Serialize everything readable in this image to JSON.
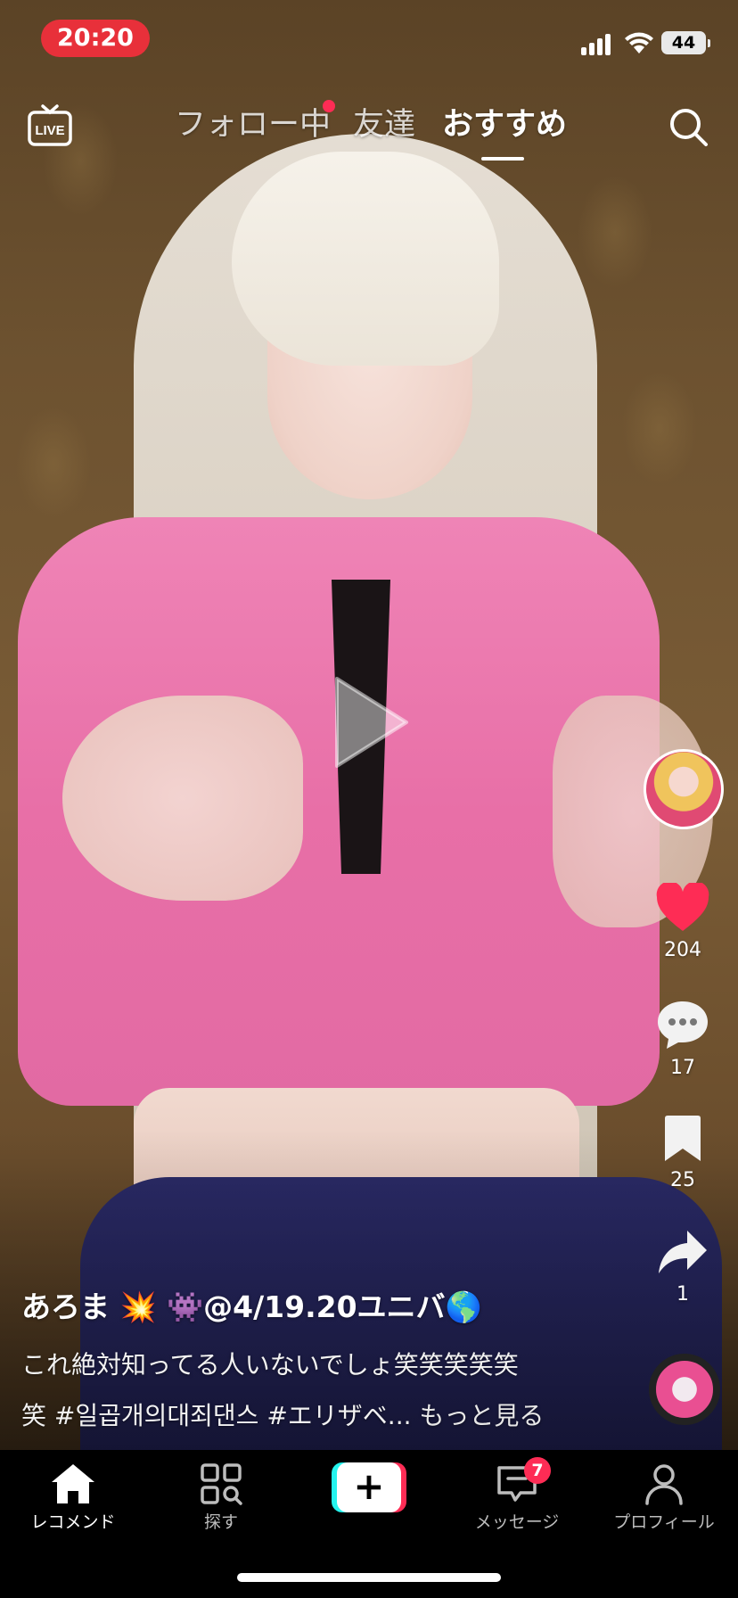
{
  "status_bar": {
    "time": "20:20",
    "battery": "44"
  },
  "top_nav": {
    "live_label": "LIVE",
    "tabs": [
      {
        "label": "フォロー中"
      },
      {
        "label": "友達"
      },
      {
        "label": "おすすめ"
      }
    ]
  },
  "actions": {
    "likes": "204",
    "comments": "17",
    "saves": "25",
    "shares": "1"
  },
  "caption": {
    "username": "あろま 💥 👾@4/19.20ユニバ🌎",
    "line1": "これ絶対知ってる人いないでしょ笑笑笑笑笑",
    "line2": "笑  #일곱개의대죄댄스 #エリザベ...",
    "more": "もっと見る"
  },
  "tabbar": {
    "home": "レコメンド",
    "discover": "探す",
    "inbox": "メッセージ",
    "inbox_badge": "7",
    "profile": "プロフィール",
    "create": "+"
  },
  "colors": {
    "accent": "#fe2c55",
    "cyan": "#25f4ee",
    "time_pill": "#e8303a"
  }
}
